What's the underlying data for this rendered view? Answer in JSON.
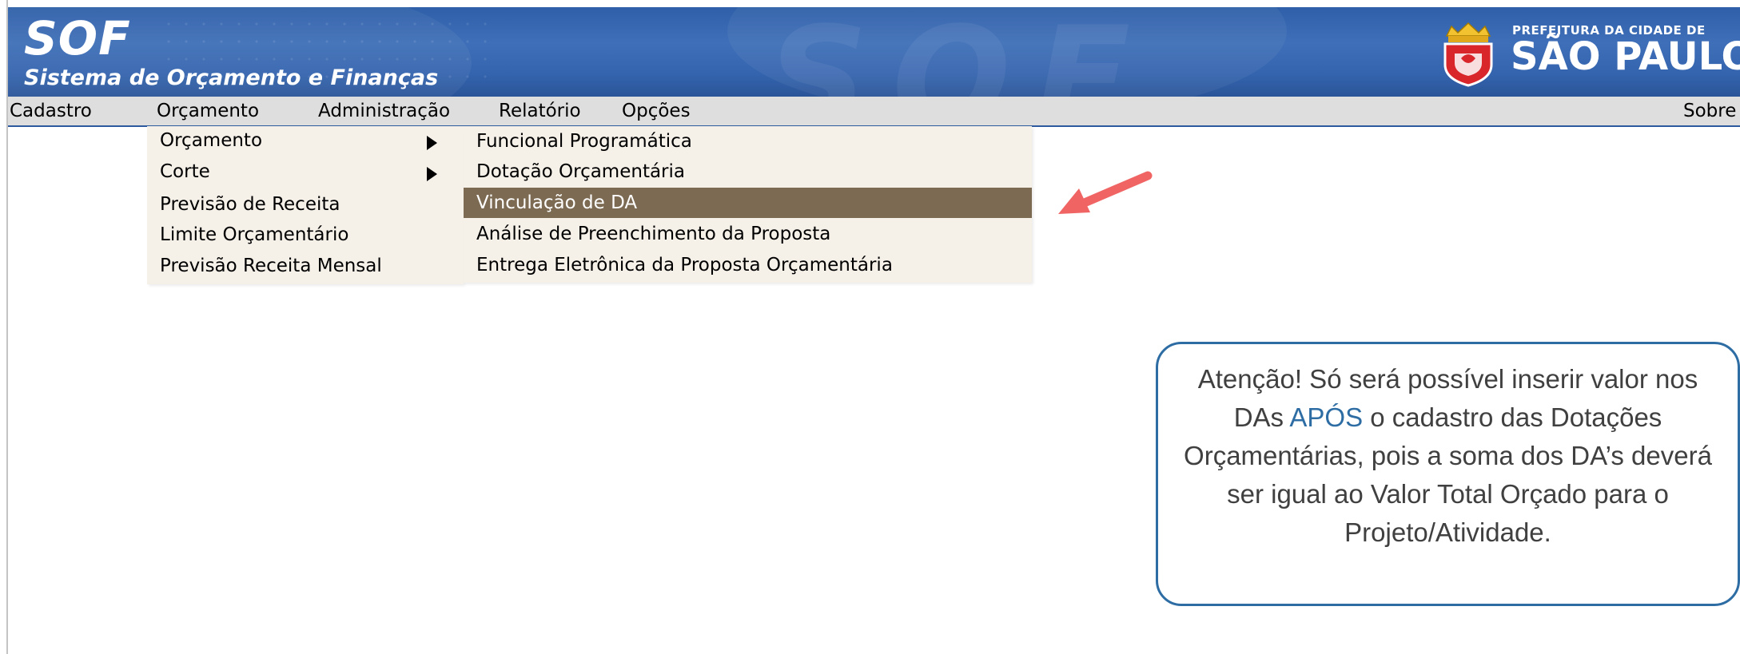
{
  "header": {
    "app_title": "SOF",
    "app_subtitle": "Sistema de Orçamento e Finanças",
    "city_logo_line1": "PREFEITURA DA CIDADE DE",
    "city_logo_line2": "SÃO PAULO",
    "crest_icon": "city-crest-icon",
    "colors": {
      "banner": "#3464ae",
      "text": "#ffffff"
    }
  },
  "menubar": {
    "items": [
      "Cadastro",
      "Orçamento",
      "Administração",
      "Relatório",
      "Opções"
    ],
    "right_item": "Sobre",
    "colors": {
      "background": "#dedede",
      "underline": "#2d5a9e"
    }
  },
  "dropdown_orcamento": {
    "items": [
      {
        "label": "Orçamento",
        "has_submenu": true
      },
      {
        "label": "Corte",
        "has_submenu": true
      },
      {
        "label": "Previsão de Receita",
        "has_submenu": false
      },
      {
        "label": "Limite Orçamentário",
        "has_submenu": false
      },
      {
        "label": "Previsão Receita Mensal",
        "has_submenu": false
      }
    ],
    "colors": {
      "background": "#f5f0e8"
    }
  },
  "submenu_orcamento": {
    "items": [
      {
        "label": "Funcional Programática",
        "highlighted": false
      },
      {
        "label": "Dotação Orçamentária",
        "highlighted": false
      },
      {
        "label": "Vinculação de DA",
        "highlighted": true
      },
      {
        "label": "Análise de Preenchimento da Proposta",
        "highlighted": false
      },
      {
        "label": "Entrega Eletrônica da Proposta Orçamentária",
        "highlighted": false
      }
    ],
    "colors": {
      "background": "#f5f0e8",
      "highlight": "#7c6a52",
      "highlight_text": "#ffffff"
    }
  },
  "annotation": {
    "arrow_icon": "red-pointer-arrow-icon",
    "arrow_color": "#f06464",
    "callout_text_before": "Atenção! Só será possível inserir valor nos DAs ",
    "callout_text_accent": "APÓS",
    "callout_text_after": " o cadastro das Dotações Orçamentárias, pois a soma dos DA’s deverá ser igual ao Valor Total Orçado para o Projeto/Atividade.",
    "colors": {
      "border": "#2e6da4",
      "accent": "#2e6da4",
      "text": "#404040"
    }
  }
}
